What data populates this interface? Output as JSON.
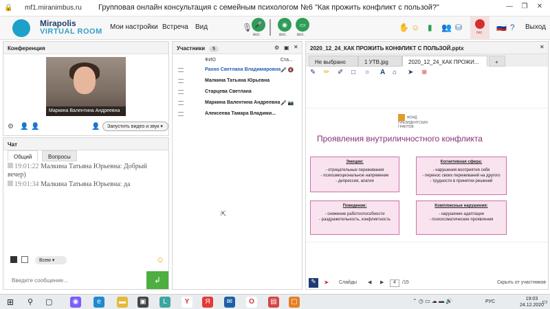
{
  "titlebar": {
    "url": "mf1.miranimbus.ru",
    "title": "Групповая онлайн консультация с семейным психологом №6 \"Как прожить конфликт с пользой?\"",
    "controls": [
      "—",
      "❐",
      "✕"
    ]
  },
  "app": {
    "logo_top": "Mirapolis",
    "logo_bottom": "VIRTUAL ROOM",
    "menu": [
      "Мои настройки",
      "Встреча",
      "Вид"
    ],
    "mic_label": "вкл.",
    "cam_label": "вкл.",
    "screen_label": "вкл.",
    "rec_label": "rec",
    "exit_label": "Выход",
    "colors": {
      "green": "#2e9d57",
      "rec": "#d32f2f",
      "accent": "#1da1c8"
    }
  },
  "conference": {
    "title": "Конференция",
    "video_caption": "Маркина Валентина  Андреевна",
    "start_video_label": "Запустить видео и звук ▾"
  },
  "chat": {
    "title": "Чат",
    "tabs": [
      "Общий",
      "Вопросы"
    ],
    "messages": [
      {
        "time": "19:01:22",
        "text": "Малкина Татьяна  Юрьевна: Добрый вечер)"
      },
      {
        "time": "19:01:34",
        "text": "Малкина Татьяна  Юрьевна: да"
      }
    ],
    "recipient": "Всем",
    "input_placeholder": "Введите сообщение...",
    "send_icon": "↲"
  },
  "participants": {
    "title": "Участники",
    "count": "5",
    "col_name": "ФИО",
    "col_status": "Ста...",
    "rows": [
      {
        "name": "Рахно Светлана  Владимировна",
        "status": "🎤 🔇",
        "highlight": true
      },
      {
        "name": "Малкина Татьяна  Юрьевна",
        "status": ""
      },
      {
        "name": "Старцева  Светлана",
        "status": ""
      },
      {
        "name": "Маркина Валентина  Андреевна",
        "status": "🎤 📷"
      },
      {
        "name": "Алексеева  Тамара  Владими...",
        "status": ""
      }
    ]
  },
  "presentation": {
    "doc_title": "2020_12_24_КАК ПРОЖИТЬ КОНФЛИКТ С ПОЛЬЗОЙ.pptx",
    "tabs": [
      "Не выбрано",
      "1 УТВ.jpg",
      "2020_12_24_КАК ПРОЖИ...",
      "+"
    ],
    "slide": {
      "logo_text": "ФОНД ПРЕЗИДЕНТСКИХ ГРАНТОВ",
      "title": "Проявления внутриличностного конфликта",
      "boxes": [
        {
          "heading": "Эмоции:",
          "lines": [
            "- отрицательные переживания",
            "- психоэмоциональное напряжение",
            "- депрессия, апатия"
          ]
        },
        {
          "heading": "Когнитивная сфера:",
          "lines": [
            "- нарушения восприятия себя",
            "- перенос своих переживаний на другого",
            "- трудности в принятии решений"
          ]
        },
        {
          "heading": "Поведение:",
          "lines": [
            "- снижение работоспособности",
            "- раздражительность, конфликтность"
          ]
        },
        {
          "heading": "Комплексные нарушения:",
          "lines": [
            "- нарушение адаптации",
            "- психосоматические проявления"
          ]
        }
      ]
    },
    "nav": {
      "slides_label": "Слайды",
      "page": "4",
      "total": "/15",
      "hide_label": "Скрыть от участников"
    }
  },
  "taskbar": {
    "lang": "РУС",
    "time": "19:03",
    "date": "24.12.2020"
  }
}
